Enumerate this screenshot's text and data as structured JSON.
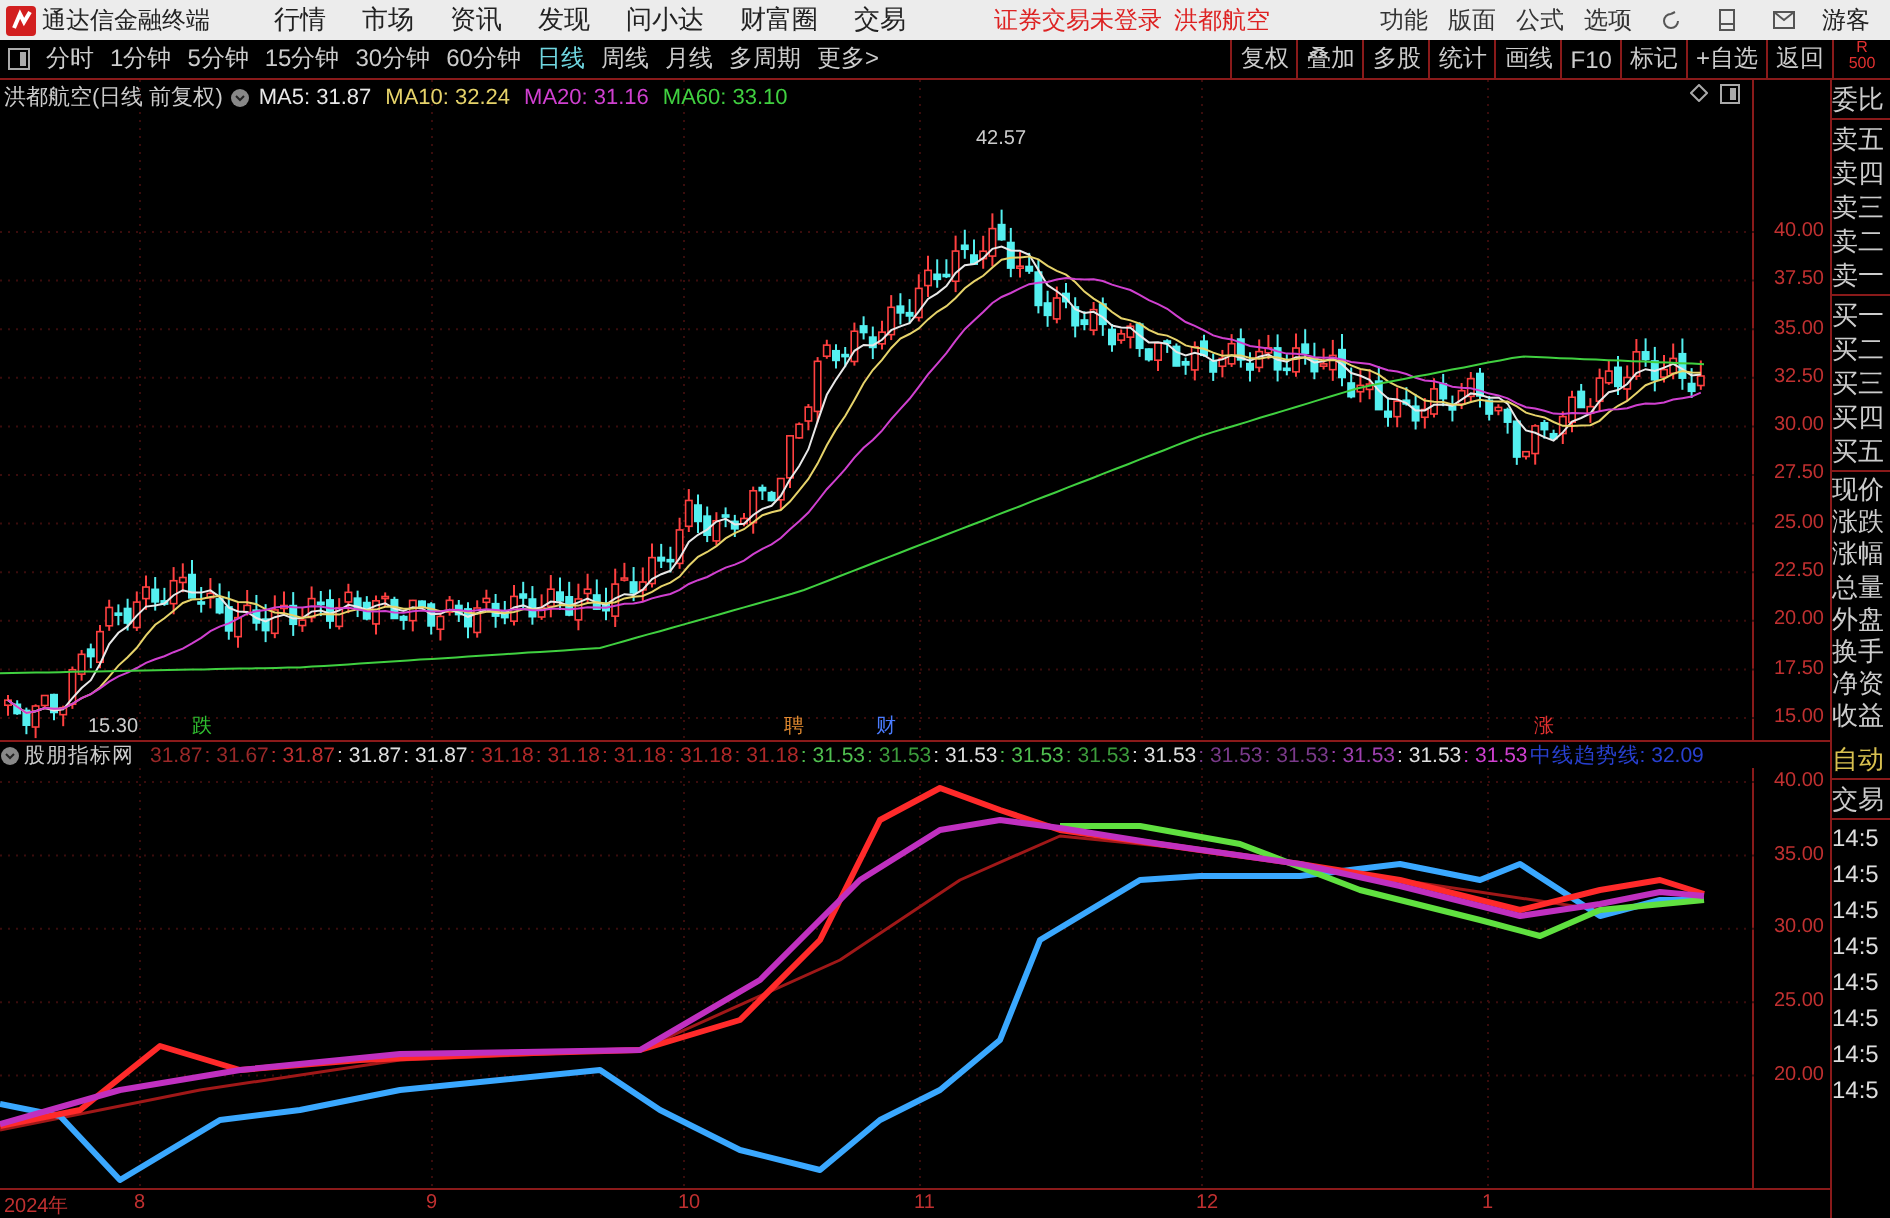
{
  "app": {
    "title": "通达信金融终端",
    "menu": [
      "行情",
      "市场",
      "资讯",
      "发现",
      "问小达",
      "财富圈",
      "交易"
    ],
    "status": "证券交易未登录",
    "stock_name": "洪都航空",
    "right_menu": [
      "功能",
      "版面",
      "公式",
      "选项"
    ],
    "user": "游客"
  },
  "toolbar": {
    "periods": [
      {
        "label": "分时",
        "selected": false
      },
      {
        "label": "1分钟",
        "selected": false
      },
      {
        "label": "5分钟",
        "selected": false
      },
      {
        "label": "15分钟",
        "selected": false
      },
      {
        "label": "30分钟",
        "selected": false
      },
      {
        "label": "60分钟",
        "selected": false
      },
      {
        "label": "日线",
        "selected": true
      },
      {
        "label": "周线",
        "selected": false
      },
      {
        "label": "月线",
        "selected": false
      },
      {
        "label": "多周期",
        "selected": false
      },
      {
        "label": "更多>",
        "selected": false
      }
    ],
    "buttons": [
      "复权",
      "叠加",
      "多股",
      "统计",
      "画线",
      "F10",
      "标记",
      "+自选",
      "返回"
    ],
    "corner": [
      "R",
      "500"
    ]
  },
  "price_chart": {
    "title": "洪都航空(日线 前复权)",
    "ma_legend": [
      {
        "label": "MA5: 31.87",
        "color": "#e8e8e8"
      },
      {
        "label": "MA10: 32.24",
        "color": "#e6d36a"
      },
      {
        "label": "MA20: 31.16",
        "color": "#d040d0"
      },
      {
        "label": "MA60: 33.10",
        "color": "#40d040"
      }
    ],
    "high_label": "42.57",
    "low_label": "15.30",
    "markers": [
      {
        "label": "跌",
        "color": "#30c030"
      },
      {
        "label": "聘",
        "color": "#e08a30"
      },
      {
        "label": "财",
        "color": "#4a7cff"
      },
      {
        "label": "涨",
        "color": "#e03030"
      }
    ],
    "yticks": [
      "40.00",
      "37.50",
      "35.00",
      "32.50",
      "30.00",
      "27.50",
      "25.00",
      "22.50",
      "20.00",
      "17.50",
      "15.00"
    ]
  },
  "indicator": {
    "name": "股朋指标网",
    "values": [
      {
        "text": "31.87",
        "color": "#9a2828"
      },
      {
        "text": ": 31.67",
        "color": "#9a2828"
      },
      {
        "text": ": 31.87",
        "color": "#c03030"
      },
      {
        "text": ": 31.87",
        "color": "#e0e0e0"
      },
      {
        "text": ": 31.87",
        "color": "#e0e0e0"
      },
      {
        "text": ": 31.18",
        "color": "#b02828"
      },
      {
        "text": ": 31.18",
        "color": "#b02828"
      },
      {
        "text": ": 31.18",
        "color": "#b02828"
      },
      {
        "text": ": 31.18",
        "color": "#b02828"
      },
      {
        "text": ": 31.18",
        "color": "#b02828"
      },
      {
        "text": ": 31.53",
        "color": "#50c050"
      },
      {
        "text": ": 31.53",
        "color": "#3c9c3c"
      },
      {
        "text": ": 31.53",
        "color": "#e0e0e0"
      },
      {
        "text": ": 31.53",
        "color": "#50c050"
      },
      {
        "text": ": 31.53",
        "color": "#3c9c3c"
      },
      {
        "text": ": 31.53",
        "color": "#e0e0e0"
      },
      {
        "text": ": 31.53",
        "color": "#7a3a8a"
      },
      {
        "text": ": 31.53",
        "color": "#7a3a8a"
      },
      {
        "text": ": 31.53",
        "color": "#a040b0"
      },
      {
        "text": ": 31.53",
        "color": "#e0e0e0"
      },
      {
        "text": ": 31.53",
        "color": "#d040d0"
      },
      {
        "text": "中线趋势线: 32.09",
        "color": "#2840d0"
      }
    ],
    "yticks": [
      "40.00",
      "35.00",
      "30.00",
      "25.00",
      "20.00"
    ]
  },
  "xaxis": [
    "2024年",
    "8",
    "9",
    "10",
    "11",
    "12",
    "1"
  ],
  "side_panel": {
    "header": "委比",
    "sell": [
      "卖五",
      "卖四",
      "卖三",
      "卖二",
      "卖一"
    ],
    "buy": [
      "买一",
      "买二",
      "买三",
      "买四",
      "买五"
    ],
    "stats": [
      "现价",
      "涨跌",
      "涨幅",
      "总量",
      "外盘",
      "换手",
      "净资",
      "收益"
    ],
    "mode": "自动",
    "trades_title": "交易",
    "trade_times": [
      "14:5",
      "14:5",
      "14:5",
      "14:5",
      "14:5",
      "14:5",
      "14:5",
      "14:5"
    ]
  }
}
